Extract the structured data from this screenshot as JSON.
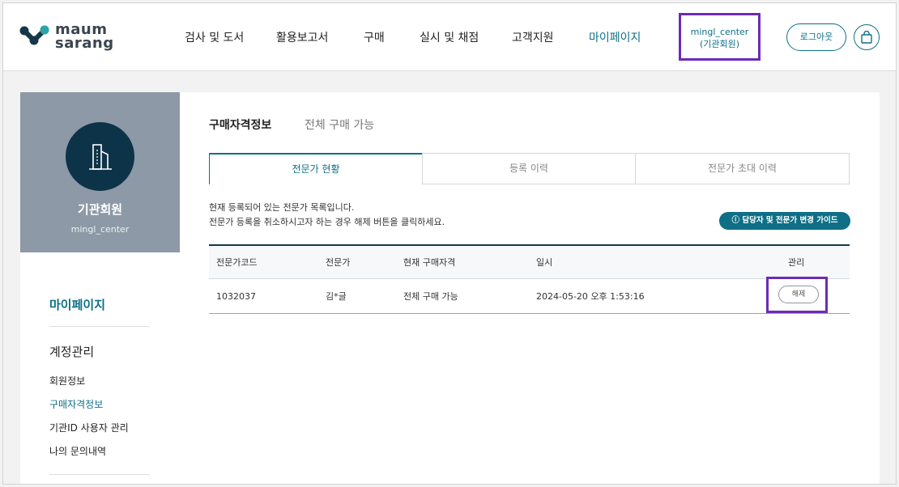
{
  "header": {
    "logo_line1": "maum",
    "logo_line2": "sarang",
    "nav": [
      "검사 및 도서",
      "활용보고서",
      "구매",
      "실시 및 채점",
      "고객지원",
      "마이페이지"
    ],
    "user_id": "mingl_center",
    "user_type": "(기관회원)",
    "logout_label": "로그아웃"
  },
  "sidebar": {
    "profile_type": "기관회원",
    "profile_id": "mingl_center",
    "title": "마이페이지",
    "group_title": "계정관리",
    "items": [
      "회원정보",
      "구매자격정보",
      "기관ID 사용자 관리",
      "나의 문의내역"
    ],
    "active_item": "구매자격정보"
  },
  "main": {
    "title": "구매자격정보",
    "subtitle": "전체 구매 가능",
    "tabs": [
      {
        "label": "전문가 현황",
        "active": true
      },
      {
        "label": "등록 이력",
        "active": false
      },
      {
        "label": "전문가 초대 이력",
        "active": false
      }
    ],
    "desc_line1": "현재 등록되어 있는 전문가 목록입니다.",
    "desc_line2": "전문가 등록을 취소하시고자 하는 경우 해제 버튼을 클릭하세요.",
    "guide_button": "ⓘ 담당자 및 전문가 변경 가이드",
    "table": {
      "headers": [
        "전문가코드",
        "전문가",
        "현재 구매자격",
        "일시",
        "관리"
      ],
      "rows": [
        {
          "code": "1032037",
          "expert": "김*글",
          "qualification": "전체 구매 가능",
          "datetime": "2024-05-20 오후 1:53:16",
          "action": "해제"
        }
      ]
    }
  },
  "colors": {
    "accent": "#0e6f86",
    "highlight": "#6c2bb8",
    "profile_bg": "#8d99a6",
    "avatar_bg": "#0d3349"
  }
}
